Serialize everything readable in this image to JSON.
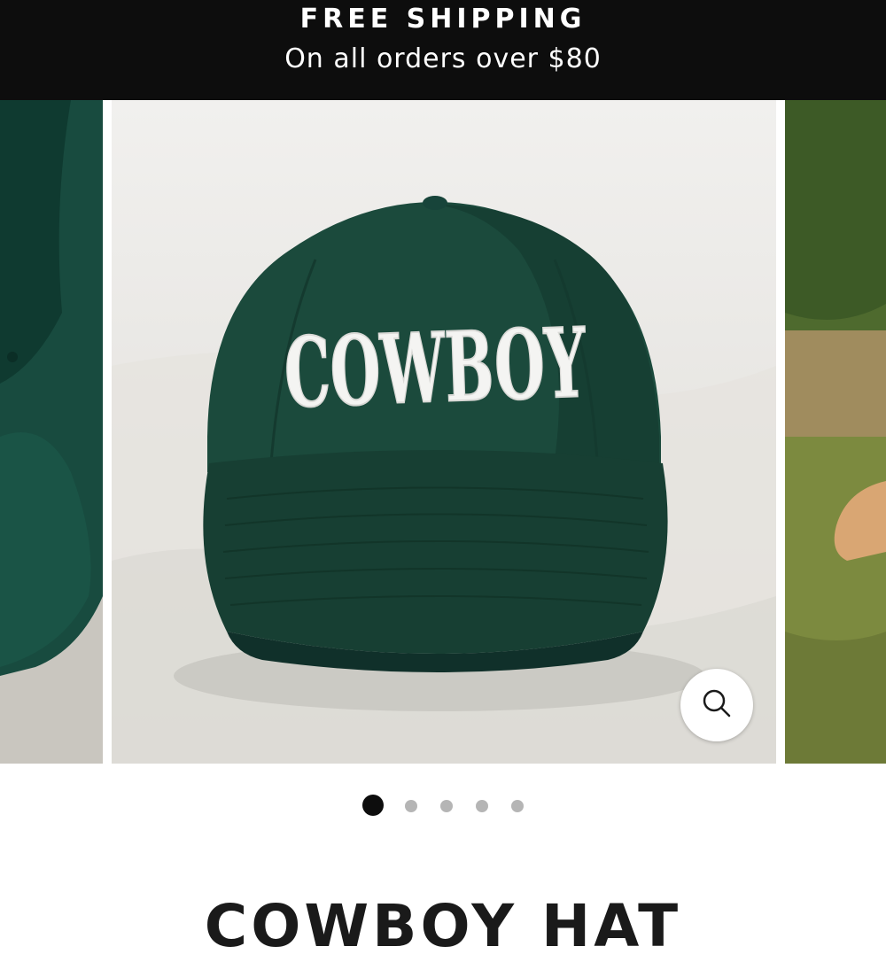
{
  "announcement": {
    "title": "FREE SHIPPING",
    "subtitle": "On all orders over $80"
  },
  "gallery": {
    "hat_text": "COWBOY",
    "zoom_icon": "search-icon",
    "slide_count": 5,
    "active_slide": 1
  },
  "product": {
    "title": "COWBOY HAT"
  },
  "colors": {
    "announcement_bg": "#0d0d0d",
    "hat_green": "#1c4a3c",
    "dot_active": "#0d0d0d",
    "dot_inactive": "#b5b5b5"
  }
}
